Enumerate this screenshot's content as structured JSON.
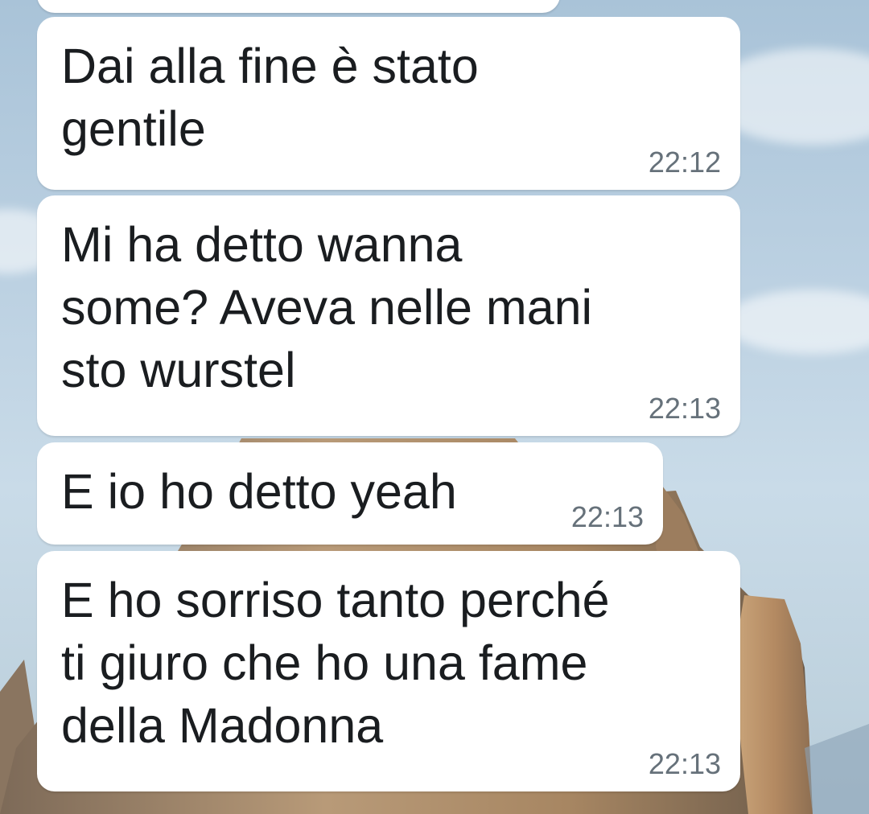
{
  "chat": {
    "messages": [
      {
        "text": "Dai alla fine è stato\ngentile",
        "time": "22:12"
      },
      {
        "text": "Mi ha detto wanna\nsome? Aveva nelle mani\nsto wurstel",
        "time": "22:13"
      },
      {
        "text": "E io ho detto yeah",
        "time": "22:13"
      },
      {
        "text": "E ho sorriso tanto perché\nti giuro che ho una fame\ndella Madonna",
        "time": "22:13"
      }
    ]
  },
  "colors": {
    "bubble": "#ffffff",
    "text": "#1a1d20",
    "timestamp": "#66717a",
    "sky": "#bcd1e2"
  }
}
